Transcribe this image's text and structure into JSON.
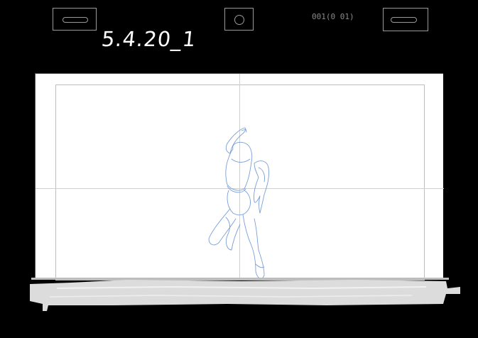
{
  "header": {
    "frame_counter": "001(0 01)",
    "scene_label": "5.4.20_1"
  },
  "peg_guides": [
    {
      "name": "left-peg-slot",
      "shape": "slot"
    },
    {
      "name": "center-peg-hole",
      "shape": "round"
    },
    {
      "name": "right-peg-slot",
      "shape": "slot"
    }
  ],
  "canvas": {
    "paper_color": "#ffffff",
    "background_color": "#000000",
    "guide_color": "#bdbdbd",
    "sketch_color": "#7a9fd9",
    "tape_color": "#dcdcdc"
  }
}
